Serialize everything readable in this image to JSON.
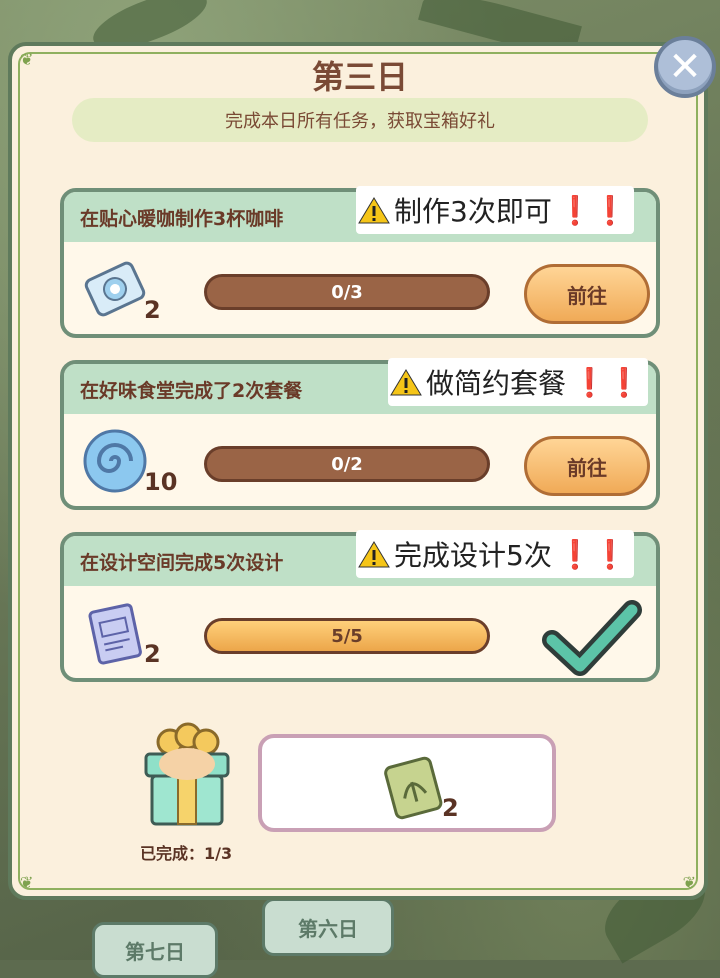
{
  "dialog": {
    "title": "第三日",
    "subtitle": "完成本日所有任务，获取宝箱好礼",
    "close_icon": "close-x-icon"
  },
  "tasks": [
    {
      "title": "在贴心暖咖制作3杯咖啡",
      "note": "制作3次即可",
      "note_marks": "❗❗",
      "reward_icon": "coffee-ticket-icon",
      "reward_count": "2",
      "progress_text": "0/3",
      "progress": 0.0,
      "action_label": "前往",
      "completed": false
    },
    {
      "title": "在好味食堂完成了2次套餐",
      "note": "做简约套餐",
      "note_marks": "❗❗",
      "reward_icon": "blue-swirl-icon",
      "reward_count": "10",
      "progress_text": "0/2",
      "progress": 0.0,
      "action_label": "前往",
      "completed": false
    },
    {
      "title": "在设计空间完成5次设计",
      "note": "完成设计5次",
      "note_marks": "❗❗",
      "reward_icon": "blueprint-scroll-icon",
      "reward_count": "2",
      "progress_text": "5/5",
      "progress": 1.0,
      "action_label": "",
      "completed": true
    }
  ],
  "chest": {
    "icon": "gift-box-icon",
    "completed_label": "已完成：1/3",
    "reward_icon": "seed-bag-icon",
    "reward_count": "2"
  },
  "background_tabs": [
    "第六日",
    "第七日"
  ],
  "colors": {
    "panel_bg": "#fbf0dd",
    "header_green": "#bfe0c7",
    "progress_brown": "#9a6446",
    "progress_fill": "#eca64a",
    "check_teal": "#5cc4a8"
  }
}
